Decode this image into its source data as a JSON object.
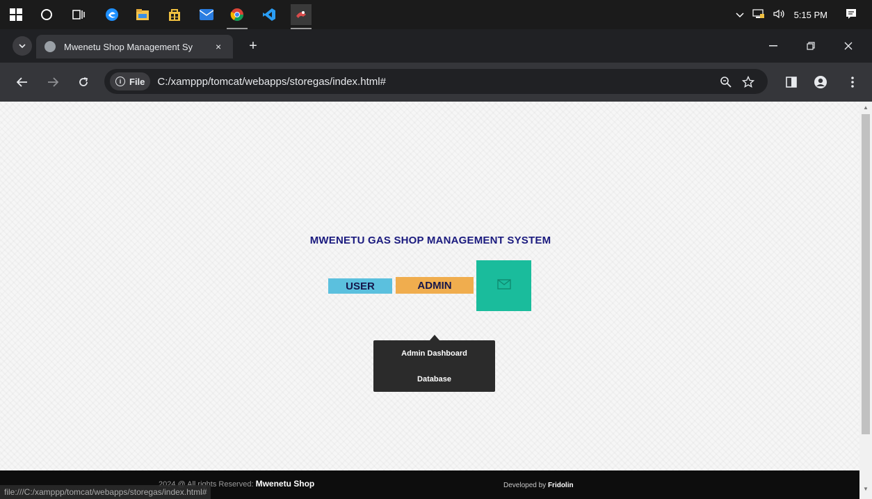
{
  "taskbar": {
    "clock": "5:15 PM",
    "tray_icons": [
      "chevron-up-icon",
      "network-icon",
      "volume-icon",
      "notification-icon"
    ],
    "apps": [
      "windows-start-icon",
      "search-circle-icon",
      "task-view-icon",
      "edge-icon",
      "file-explorer-icon",
      "store-icon",
      "mail-icon",
      "chrome-icon",
      "vscode-icon",
      "app-icon"
    ]
  },
  "browser": {
    "tab_title": "Mwenetu Shop Management Sy",
    "tab_close": "×",
    "new_tab": "+",
    "file_chip": "File",
    "url": "C:/xamppp/tomcat/webapps/storegas/index.html#"
  },
  "page": {
    "title": "MWENETU GAS SHOP MANAGEMENT SYSTEM",
    "user_button": "USER",
    "admin_button": "ADMIN",
    "dropdown": {
      "items": [
        "Admin Dashboard",
        "Database"
      ]
    }
  },
  "footer": {
    "copyright_prefix": "2024 @ All rights Reserved:",
    "shop_name": "Mwenetu Shop",
    "developed_prefix": "Developed by",
    "developer": "Fridolin"
  },
  "status_bar": {
    "url": "file:///C:/xamppp/tomcat/webapps/storegas/index.html#"
  },
  "colors": {
    "user_button": "#5bc0de",
    "admin_button": "#f0ad4e",
    "mail_button": "#1abc9c",
    "title_text": "#1a1a7e",
    "dropdown_bg": "#2b2b2b",
    "footer_bg": "#0d0d0d"
  }
}
